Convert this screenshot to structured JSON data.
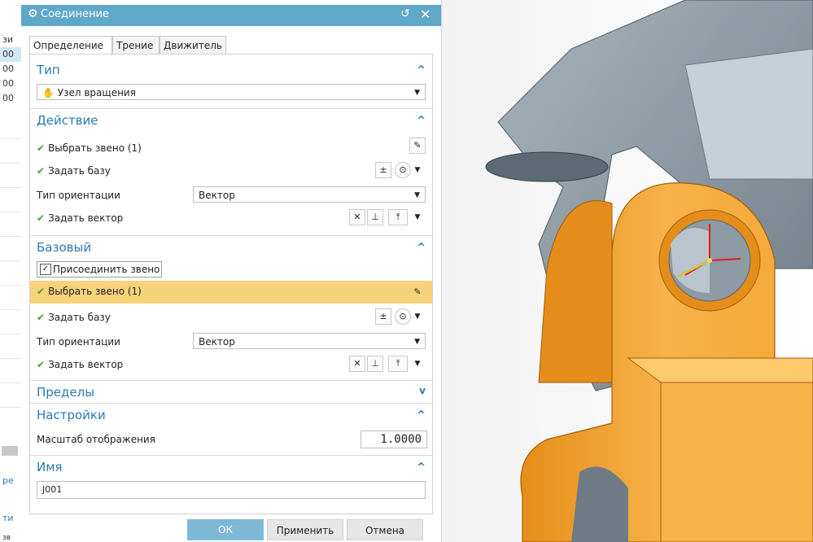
{
  "colors": {
    "title_bar": "#5fa8c8",
    "accent": "#2a7ab0",
    "highlight": "#f6d27a",
    "ok_button": "#7fb8d6",
    "orange_part": "#f5a42a",
    "gray_part": "#8a97a0"
  },
  "left_strip": {
    "rows": [
      "зи",
      "00",
      "00",
      "00",
      "00"
    ],
    "bottom_labels": [
      "ре",
      "ти",
      "зв"
    ]
  },
  "dialog": {
    "title": "Соединение",
    "icons": {
      "settings": "gear-icon",
      "reset": "reset-icon",
      "close": "close-icon"
    },
    "tabs": [
      "Определение",
      "Трение",
      "Движитель"
    ],
    "sections": {
      "type": {
        "title": "Тип",
        "value": "Узел вращения"
      },
      "action": {
        "title": "Действие",
        "select_link": "Выбрать звено (1)",
        "specify_base": "Задать базу",
        "orientation_label": "Тип ориентации",
        "orientation_value": "Вектор",
        "specify_vector": "Задать вектор"
      },
      "base": {
        "title": "Базовый",
        "attach_link": "Присоединить звено",
        "select_link": "Выбрать звено (1)",
        "specify_base": "Задать базу",
        "orientation_label": "Тип ориентации",
        "orientation_value": "Вектор",
        "specify_vector": "Задать вектор"
      },
      "limits": {
        "title": "Пределы"
      },
      "settings": {
        "title": "Настройки",
        "scale_label": "Масштаб отображения",
        "scale_value": "1.0000"
      },
      "name": {
        "title": "Имя",
        "value": "J001"
      }
    },
    "buttons": {
      "ok": "ОК",
      "apply": "Применить",
      "cancel": "Отмена"
    }
  }
}
